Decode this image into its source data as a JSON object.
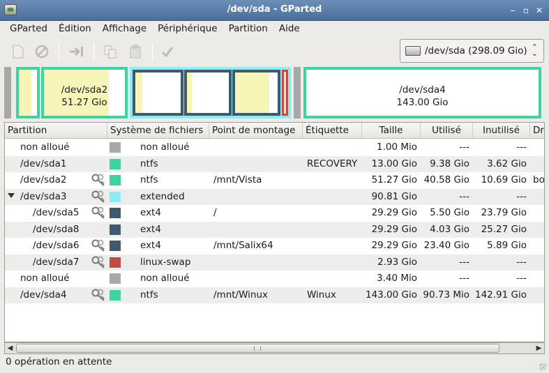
{
  "window": {
    "title": "/dev/sda - GParted",
    "controls": [
      "‒",
      "▫",
      "✕"
    ]
  },
  "menu": [
    "GParted",
    "Édition",
    "Affichage",
    "Périphérique",
    "Partition",
    "Aide"
  ],
  "toolbar": {
    "icons": [
      "new-icon",
      "delete-icon",
      "resize-move-icon",
      "copy-icon",
      "paste-icon",
      "apply-icon"
    ]
  },
  "device": {
    "label": "/dev/sda  (298.09 Gio)",
    "icon": "harddisk-icon"
  },
  "diskmap": {
    "sda2": {
      "name": "/dev/sda2",
      "size": "51.27 Gio"
    },
    "sda4": {
      "name": "/dev/sda4",
      "size": "143.00 Gio"
    }
  },
  "colors": {
    "unallocated": "#a8a8a8",
    "ntfs": "#3ed3a0",
    "extended": "#8ceef5",
    "ext4": "#40596e",
    "linux-swap": "#c04c44",
    "used": "#f7f4b8"
  },
  "table": {
    "headers": [
      "Partition",
      "Système de fichiers",
      "Point de montage",
      "Étiquette",
      "Taille",
      "Utilisé",
      "Inutilisé",
      "Dr"
    ],
    "rows": [
      {
        "partition": "non alloué",
        "fs": "non alloué",
        "mount": "",
        "label": "",
        "size": "1.00 Mio",
        "used": "---",
        "unused": "---",
        "flags": "",
        "color": "#a8a8a8",
        "key": false,
        "level": 0
      },
      {
        "partition": "/dev/sda1",
        "fs": "ntfs",
        "mount": "",
        "label": "RECOVERY",
        "size": "13.00 Gio",
        "used": "9.38 Gio",
        "unused": "3.62 Gio",
        "flags": "",
        "color": "#3ed3a0",
        "key": false,
        "level": 0
      },
      {
        "partition": "/dev/sda2",
        "fs": "ntfs",
        "mount": "/mnt/Vista",
        "label": "",
        "size": "51.27 Gio",
        "used": "40.58 Gio",
        "unused": "10.69 Gio",
        "flags": "bo",
        "color": "#3ed3a0",
        "key": true,
        "level": 0
      },
      {
        "partition": "/dev/sda3",
        "fs": "extended",
        "mount": "",
        "label": "",
        "size": "90.81 Gio",
        "used": "---",
        "unused": "---",
        "flags": "",
        "color": "#8ceef5",
        "key": true,
        "level": 0,
        "expander": true
      },
      {
        "partition": "/dev/sda5",
        "fs": "ext4",
        "mount": "/",
        "label": "",
        "size": "29.29 Gio",
        "used": "5.50 Gio",
        "unused": "23.79 Gio",
        "flags": "",
        "color": "#40596e",
        "key": true,
        "level": 1
      },
      {
        "partition": "/dev/sda8",
        "fs": "ext4",
        "mount": "",
        "label": "",
        "size": "29.29 Gio",
        "used": "4.03 Gio",
        "unused": "25.27 Gio",
        "flags": "",
        "color": "#40596e",
        "key": false,
        "level": 1
      },
      {
        "partition": "/dev/sda6",
        "fs": "ext4",
        "mount": "/mnt/Salix64",
        "label": "",
        "size": "29.29 Gio",
        "used": "23.40 Gio",
        "unused": "5.89 Gio",
        "flags": "",
        "color": "#40596e",
        "key": true,
        "level": 1
      },
      {
        "partition": "/dev/sda7",
        "fs": "linux-swap",
        "mount": "",
        "label": "",
        "size": "2.93 Gio",
        "used": "---",
        "unused": "---",
        "flags": "",
        "color": "#c04c44",
        "key": true,
        "level": 1
      },
      {
        "partition": "non alloué",
        "fs": "non alloué",
        "mount": "",
        "label": "",
        "size": "3.40 Mio",
        "used": "---",
        "unused": "---",
        "flags": "",
        "color": "#a8a8a8",
        "key": false,
        "level": 0
      },
      {
        "partition": "/dev/sda4",
        "fs": "ntfs",
        "mount": "/mnt/Winux",
        "label": "Winux",
        "size": "143.00 Gio",
        "used": "90.73 Mio",
        "unused": "142.91 Gio",
        "flags": "",
        "color": "#3ed3a0",
        "key": true,
        "level": 0
      }
    ]
  },
  "status": "0 opération en attente"
}
